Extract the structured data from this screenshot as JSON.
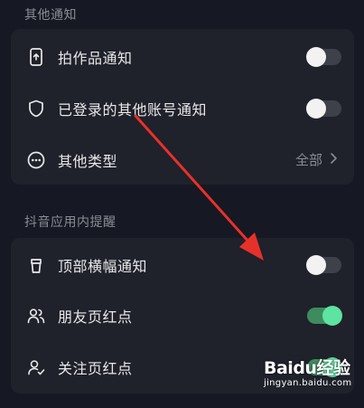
{
  "sections": [
    {
      "title": "其他通知",
      "items": [
        {
          "label": "拍作品通知",
          "icon": "phone-upload-icon",
          "control": "toggle",
          "on": false
        },
        {
          "label": "已登录的其他账号通知",
          "icon": "shield-icon",
          "control": "toggle",
          "on": false
        },
        {
          "label": "其他类型",
          "icon": "more-circle-icon",
          "control": "value",
          "value": "全部"
        }
      ]
    },
    {
      "title": "抖音应用内提醒",
      "items": [
        {
          "label": "顶部横幅通知",
          "icon": "cup-icon",
          "control": "toggle",
          "on": false
        },
        {
          "label": "朋友页红点",
          "icon": "friends-icon",
          "control": "toggle",
          "on": true
        },
        {
          "label": "关注页红点",
          "icon": "user-check-icon",
          "control": "toggle",
          "on": true
        }
      ]
    }
  ],
  "watermark": {
    "logo": "Baidu经验",
    "url": "jingyan.baidu.com"
  },
  "colors": {
    "background": "#161823",
    "card": "#1f212b",
    "toggle_on": "#5ee3a0",
    "annotation_arrow": "#e8302a"
  }
}
